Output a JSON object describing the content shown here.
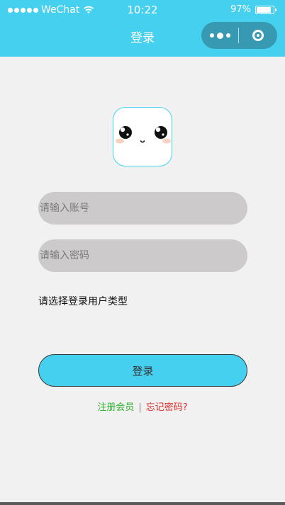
{
  "status_bar": {
    "carrier": "WeChat",
    "time": "10:22",
    "battery": "97%"
  },
  "navbar": {
    "title": "登录"
  },
  "form": {
    "account_placeholder": "请输入账号",
    "password_placeholder": "请输入密码",
    "user_type_label": "请选择登录用户类型"
  },
  "login_button": "登录",
  "links": {
    "register": "注册会员",
    "separator": "|",
    "forgot": "忘记密码?"
  },
  "colors": {
    "accent": "#46d0ef",
    "capsule": "#3799b2",
    "input_bg": "#cccaca",
    "register": "#2db52d",
    "forgot": "#d9302a"
  },
  "icons": {
    "wifi": "wifi-icon",
    "battery": "battery-icon",
    "menu": "more-icon",
    "close": "close-icon",
    "avatar": "cute-face-icon"
  }
}
